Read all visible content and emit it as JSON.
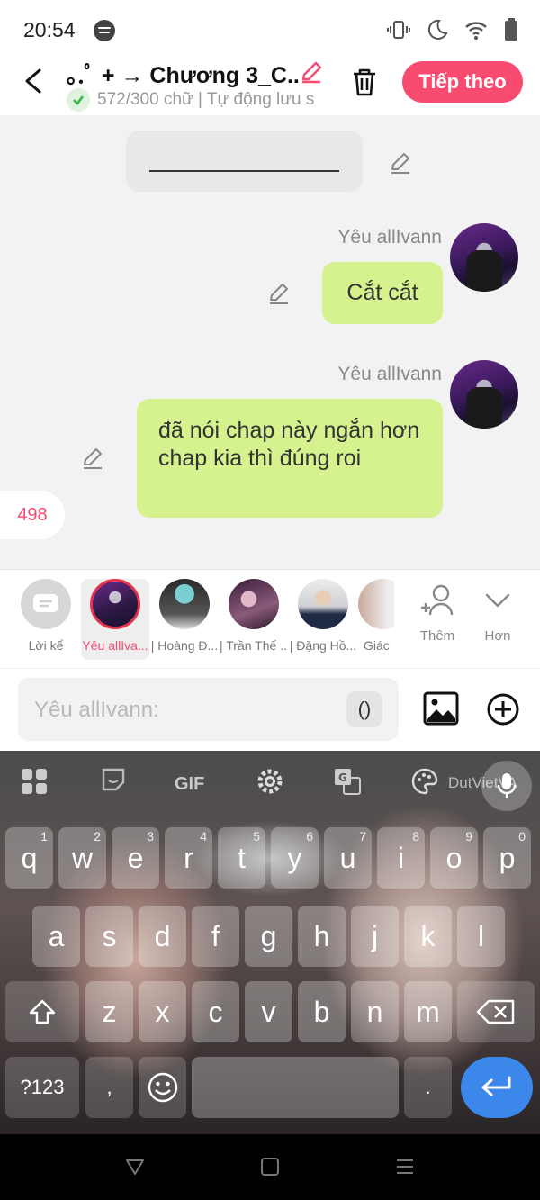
{
  "status_bar": {
    "time": "20:54",
    "icons": [
      "spotify-icon",
      "vibrate-icon",
      "moon-icon",
      "wifi-icon",
      "battery-icon"
    ]
  },
  "header": {
    "title": "｡.ﾟ + → Chương 3_C...",
    "subtitle": "572/300 chữ | Tự động lưu s",
    "next_label": "Tiếp theo",
    "accent": "#f94a6f"
  },
  "chat": {
    "messages": [
      {
        "sender": "Yêu allIvann",
        "text": "Cắt cắt"
      },
      {
        "sender": "Yêu allIvann",
        "text": "đã nói chap này ngắn hơn chap kia thì đúng roi"
      }
    ],
    "counter": "498",
    "bubble_color": "#d5f28e"
  },
  "characters": [
    {
      "label": "Lời kể",
      "selected": false
    },
    {
      "label": "Yêu allIva...",
      "selected": true
    },
    {
      "label": "| Hoàng Đ...",
      "selected": false
    },
    {
      "label": "| Trần Thế ...",
      "selected": false
    },
    {
      "label": "| Đặng Hồ...",
      "selected": false
    },
    {
      "label": "Giác",
      "selected": false
    }
  ],
  "tools": {
    "add_label": "Thêm",
    "more_label": "Hơn"
  },
  "composer": {
    "placeholder": "Yêu allIvann:",
    "paren_label": "()"
  },
  "keyboard": {
    "toolbar": [
      "apps-icon",
      "sticker-icon",
      "GIF",
      "settings-icon",
      "translate-icon",
      "palette-icon",
      "DutVietVA",
      "mic-icon"
    ],
    "row1": [
      {
        "k": "q",
        "h": "1"
      },
      {
        "k": "w",
        "h": "2"
      },
      {
        "k": "e",
        "h": "3"
      },
      {
        "k": "r",
        "h": "4"
      },
      {
        "k": "t",
        "h": "5"
      },
      {
        "k": "y",
        "h": "6"
      },
      {
        "k": "u",
        "h": "7"
      },
      {
        "k": "i",
        "h": "8"
      },
      {
        "k": "o",
        "h": "9"
      },
      {
        "k": "p",
        "h": "0"
      }
    ],
    "row2": [
      "a",
      "s",
      "d",
      "f",
      "g",
      "h",
      "j",
      "k",
      "l"
    ],
    "row3": [
      "z",
      "x",
      "c",
      "v",
      "b",
      "n",
      "m"
    ],
    "sym_label": "?123",
    "comma": ",",
    "period": "."
  }
}
